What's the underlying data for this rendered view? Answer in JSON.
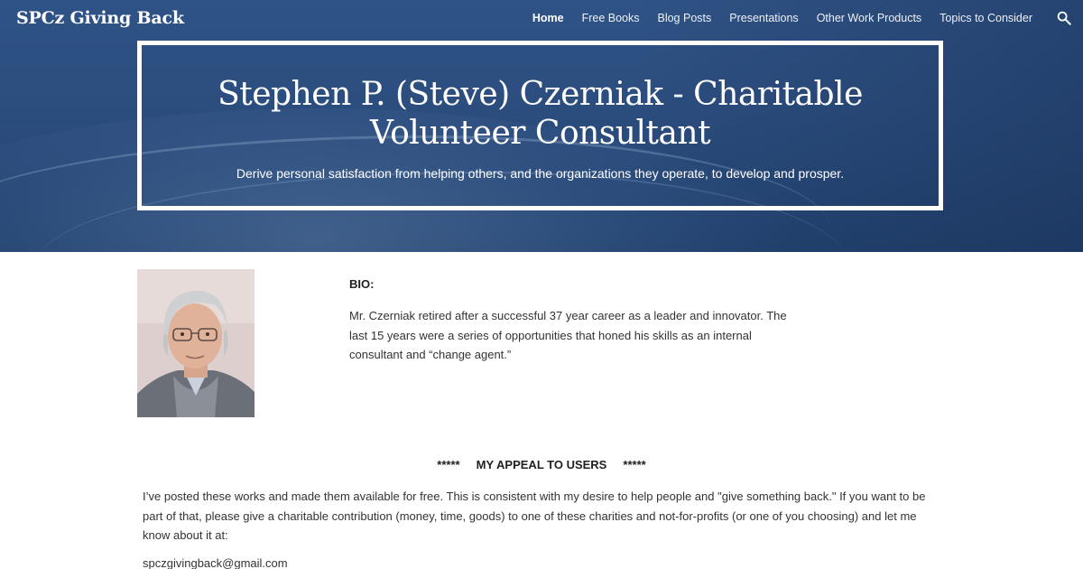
{
  "header": {
    "site_title": "SPCz Giving Back",
    "nav": [
      {
        "label": "Home",
        "active": true
      },
      {
        "label": "Free Books",
        "active": false
      },
      {
        "label": "Blog Posts",
        "active": false
      },
      {
        "label": "Presentations",
        "active": false
      },
      {
        "label": "Other Work Products",
        "active": false
      },
      {
        "label": "Topics to Consider",
        "active": false
      }
    ],
    "search_icon": "search-icon"
  },
  "hero": {
    "title": "Stephen P. (Steve) Czerniak - Charitable Volunteer Consultant",
    "subtitle": "Derive personal satisfaction from helping others, and the organizations they operate, to develop and prosper.",
    "background_color": "#2b4d7e"
  },
  "bio": {
    "heading": "BIO:",
    "text": "Mr. Czerniak retired after a successful 37 year career as a leader and innovator. The last 15 years were a series of opportunities that honed his skills as an internal consultant and “change agent.”"
  },
  "appeal": {
    "heading": "*****     MY APPEAL TO USERS     *****",
    "text": "I’ve posted these works and made them available for free. This is consistent with my desire to help people and \"give something back.\" If you want to be part of that, please give a charitable contribution (money, time, goods) to one of these charities and not-for-profits (or one of you choosing) and let me know about it at:",
    "email": "spczgivingback@gmail.com"
  }
}
